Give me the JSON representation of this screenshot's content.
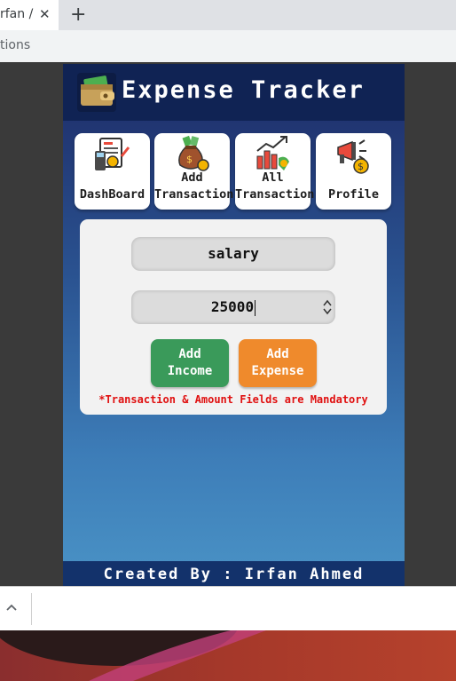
{
  "browser": {
    "tab_title": "rfan /",
    "tab_close": "✕",
    "new_tab": "+",
    "url_fragment": "tions"
  },
  "app": {
    "title": "Expense Tracker",
    "logo_icon": "wallet-cash-icon",
    "nav": [
      {
        "label_lines": [
          "DashBoard"
        ],
        "icon": "dashboard-report-icon"
      },
      {
        "label_lines": [
          "Add",
          "Transaction"
        ],
        "icon": "money-bag-icon"
      },
      {
        "label_lines": [
          "All",
          "Transaction"
        ],
        "icon": "growth-chart-icon"
      },
      {
        "label_lines": [
          "Profile"
        ],
        "icon": "megaphone-dollar-icon"
      }
    ],
    "form": {
      "transaction_value": "salary",
      "amount_value": "25000",
      "add_income_lines": [
        "Add",
        "Income"
      ],
      "add_expense_lines": [
        "Add",
        "Expense"
      ],
      "mandatory_note": "*Transaction & Amount Fields are Mandatory"
    },
    "footer": "Created By : Irfan Ahmed"
  },
  "colors": {
    "header_bg": "#102354",
    "income_button": "#3a9a5a",
    "expense_button": "#ef8a2c",
    "error_text": "#e01010"
  }
}
